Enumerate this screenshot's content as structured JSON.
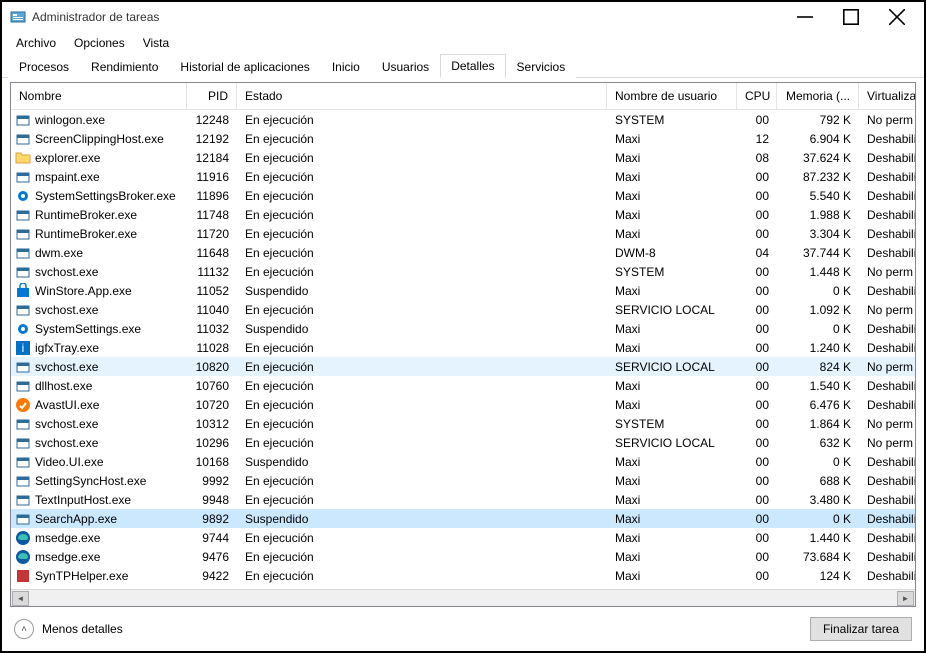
{
  "window": {
    "title": "Administrador de tareas"
  },
  "menu": [
    "Archivo",
    "Opciones",
    "Vista"
  ],
  "tabs": [
    {
      "label": "Procesos",
      "active": false
    },
    {
      "label": "Rendimiento",
      "active": false
    },
    {
      "label": "Historial de aplicaciones",
      "active": false
    },
    {
      "label": "Inicio",
      "active": false
    },
    {
      "label": "Usuarios",
      "active": false
    },
    {
      "label": "Detalles",
      "active": true
    },
    {
      "label": "Servicios",
      "active": false
    }
  ],
  "columns": {
    "name": "Nombre",
    "pid": "PID",
    "status": "Estado",
    "user": "Nombre de usuario",
    "cpu": "CPU",
    "memory": "Memoria (...",
    "virt": "Virtualiza"
  },
  "rows": [
    {
      "icon": "win",
      "name": "winlogon.exe",
      "pid": "12248",
      "status": "En ejecución",
      "user": "SYSTEM",
      "cpu": "00",
      "mem": "792 K",
      "virt": "No perm"
    },
    {
      "icon": "win",
      "name": "ScreenClippingHost.exe",
      "pid": "12192",
      "status": "En ejecución",
      "user": "Maxi",
      "cpu": "12",
      "mem": "6.904 K",
      "virt": "Deshabili"
    },
    {
      "icon": "explorer",
      "name": "explorer.exe",
      "pid": "12184",
      "status": "En ejecución",
      "user": "Maxi",
      "cpu": "08",
      "mem": "37.624 K",
      "virt": "Deshabili"
    },
    {
      "icon": "win",
      "name": "mspaint.exe",
      "pid": "11916",
      "status": "En ejecución",
      "user": "Maxi",
      "cpu": "00",
      "mem": "87.232 K",
      "virt": "Deshabili"
    },
    {
      "icon": "gear",
      "name": "SystemSettingsBroker.exe",
      "pid": "11896",
      "status": "En ejecución",
      "user": "Maxi",
      "cpu": "00",
      "mem": "5.540 K",
      "virt": "Deshabili"
    },
    {
      "icon": "win",
      "name": "RuntimeBroker.exe",
      "pid": "11748",
      "status": "En ejecución",
      "user": "Maxi",
      "cpu": "00",
      "mem": "1.988 K",
      "virt": "Deshabili"
    },
    {
      "icon": "win",
      "name": "RuntimeBroker.exe",
      "pid": "11720",
      "status": "En ejecución",
      "user": "Maxi",
      "cpu": "00",
      "mem": "3.304 K",
      "virt": "Deshabili"
    },
    {
      "icon": "win",
      "name": "dwm.exe",
      "pid": "11648",
      "status": "En ejecución",
      "user": "DWM-8",
      "cpu": "04",
      "mem": "37.744 K",
      "virt": "Deshabili"
    },
    {
      "icon": "svc",
      "name": "svchost.exe",
      "pid": "11132",
      "status": "En ejecución",
      "user": "SYSTEM",
      "cpu": "00",
      "mem": "1.448 K",
      "virt": "No perm"
    },
    {
      "icon": "store",
      "name": "WinStore.App.exe",
      "pid": "11052",
      "status": "Suspendido",
      "user": "Maxi",
      "cpu": "00",
      "mem": "0 K",
      "virt": "Deshabili"
    },
    {
      "icon": "svc",
      "name": "svchost.exe",
      "pid": "11040",
      "status": "En ejecución",
      "user": "SERVICIO LOCAL",
      "cpu": "00",
      "mem": "1.092 K",
      "virt": "No perm"
    },
    {
      "icon": "gear",
      "name": "SystemSettings.exe",
      "pid": "11032",
      "status": "Suspendido",
      "user": "Maxi",
      "cpu": "00",
      "mem": "0 K",
      "virt": "Deshabili"
    },
    {
      "icon": "intel",
      "name": "igfxTray.exe",
      "pid": "11028",
      "status": "En ejecución",
      "user": "Maxi",
      "cpu": "00",
      "mem": "1.240 K",
      "virt": "Deshabili"
    },
    {
      "icon": "svc",
      "name": "svchost.exe",
      "pid": "10820",
      "status": "En ejecución",
      "user": "SERVICIO LOCAL",
      "cpu": "00",
      "mem": "824 K",
      "virt": "No perm",
      "highlight": true
    },
    {
      "icon": "win",
      "name": "dllhost.exe",
      "pid": "10760",
      "status": "En ejecución",
      "user": "Maxi",
      "cpu": "00",
      "mem": "1.540 K",
      "virt": "Deshabili"
    },
    {
      "icon": "avast",
      "name": "AvastUI.exe",
      "pid": "10720",
      "status": "En ejecución",
      "user": "Maxi",
      "cpu": "00",
      "mem": "6.476 K",
      "virt": "Deshabili"
    },
    {
      "icon": "svc",
      "name": "svchost.exe",
      "pid": "10312",
      "status": "En ejecución",
      "user": "SYSTEM",
      "cpu": "00",
      "mem": "1.864 K",
      "virt": "No perm"
    },
    {
      "icon": "svc",
      "name": "svchost.exe",
      "pid": "10296",
      "status": "En ejecución",
      "user": "SERVICIO LOCAL",
      "cpu": "00",
      "mem": "632 K",
      "virt": "No perm"
    },
    {
      "icon": "win",
      "name": "Video.UI.exe",
      "pid": "10168",
      "status": "Suspendido",
      "user": "Maxi",
      "cpu": "00",
      "mem": "0 K",
      "virt": "Deshabili"
    },
    {
      "icon": "win",
      "name": "SettingSyncHost.exe",
      "pid": "9992",
      "status": "En ejecución",
      "user": "Maxi",
      "cpu": "00",
      "mem": "688 K",
      "virt": "Deshabili"
    },
    {
      "icon": "win",
      "name": "TextInputHost.exe",
      "pid": "9948",
      "status": "En ejecución",
      "user": "Maxi",
      "cpu": "00",
      "mem": "3.480 K",
      "virt": "Deshabili"
    },
    {
      "icon": "win",
      "name": "SearchApp.exe",
      "pid": "9892",
      "status": "Suspendido",
      "user": "Maxi",
      "cpu": "00",
      "mem": "0 K",
      "virt": "Deshabili",
      "selected": true
    },
    {
      "icon": "edge",
      "name": "msedge.exe",
      "pid": "9744",
      "status": "En ejecución",
      "user": "Maxi",
      "cpu": "00",
      "mem": "1.440 K",
      "virt": "Deshabili"
    },
    {
      "icon": "edge",
      "name": "msedge.exe",
      "pid": "9476",
      "status": "En ejecución",
      "user": "Maxi",
      "cpu": "00",
      "mem": "73.684 K",
      "virt": "Deshabili"
    },
    {
      "icon": "generic",
      "name": "SynTPHelper.exe",
      "pid": "9422",
      "status": "En ejecución",
      "user": "Maxi",
      "cpu": "00",
      "mem": "124 K",
      "virt": "Deshabili"
    }
  ],
  "footer": {
    "fewer": "Menos detalles",
    "end": "Finalizar tarea"
  }
}
